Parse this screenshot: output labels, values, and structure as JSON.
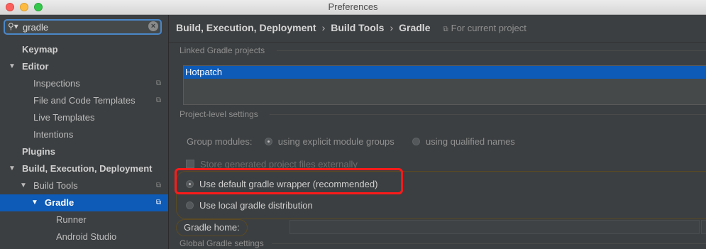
{
  "window": {
    "title": "Preferences"
  },
  "search": {
    "value": "gradle"
  },
  "tree": [
    {
      "label": "Keymap",
      "bold": true,
      "arrow": "",
      "level": 0
    },
    {
      "label": "Editor",
      "bold": true,
      "arrow": "▼",
      "level": 0
    },
    {
      "label": "Inspections",
      "level": 1,
      "copy": true
    },
    {
      "label": "File and Code Templates",
      "level": 1,
      "copy": true
    },
    {
      "label": "Live Templates",
      "level": 1
    },
    {
      "label": "Intentions",
      "level": 1
    },
    {
      "label": "Plugins",
      "bold": true,
      "level": 0
    },
    {
      "label": "Build, Execution, Deployment",
      "bold": true,
      "arrow": "▼",
      "level": 0
    },
    {
      "label": "Build Tools",
      "level": 1,
      "arrow": "▼",
      "copy": true
    },
    {
      "label": "Gradle",
      "level": 2,
      "arrow": "▼",
      "copy": true,
      "selected": true,
      "bold": true
    },
    {
      "label": "Runner",
      "level": 3
    },
    {
      "label": "Android Studio",
      "level": 3
    }
  ],
  "breadcrumb": {
    "part1": "Build, Execution, Deployment",
    "part2": "Build Tools",
    "part3": "Gradle",
    "scope": "For current project"
  },
  "linked": {
    "header": "Linked Gradle projects",
    "items": [
      "Hotpatch"
    ]
  },
  "project_level": {
    "header": "Project-level settings",
    "group_modules_label": "Group modules:",
    "group_opt1": "using explicit module groups",
    "group_opt2": "using qualified names",
    "store_generated": "Store generated project files externally",
    "wrapper_option": "Use default gradle wrapper (recommended)",
    "local_option": "Use local gradle distribution",
    "gradle_home_label": "Gradle home:"
  },
  "global": {
    "header": "Global Gradle settings"
  },
  "colors": {
    "selection": "#0d5ab7",
    "highlight": "#ff1a1a",
    "accent": "#4a87c9"
  }
}
